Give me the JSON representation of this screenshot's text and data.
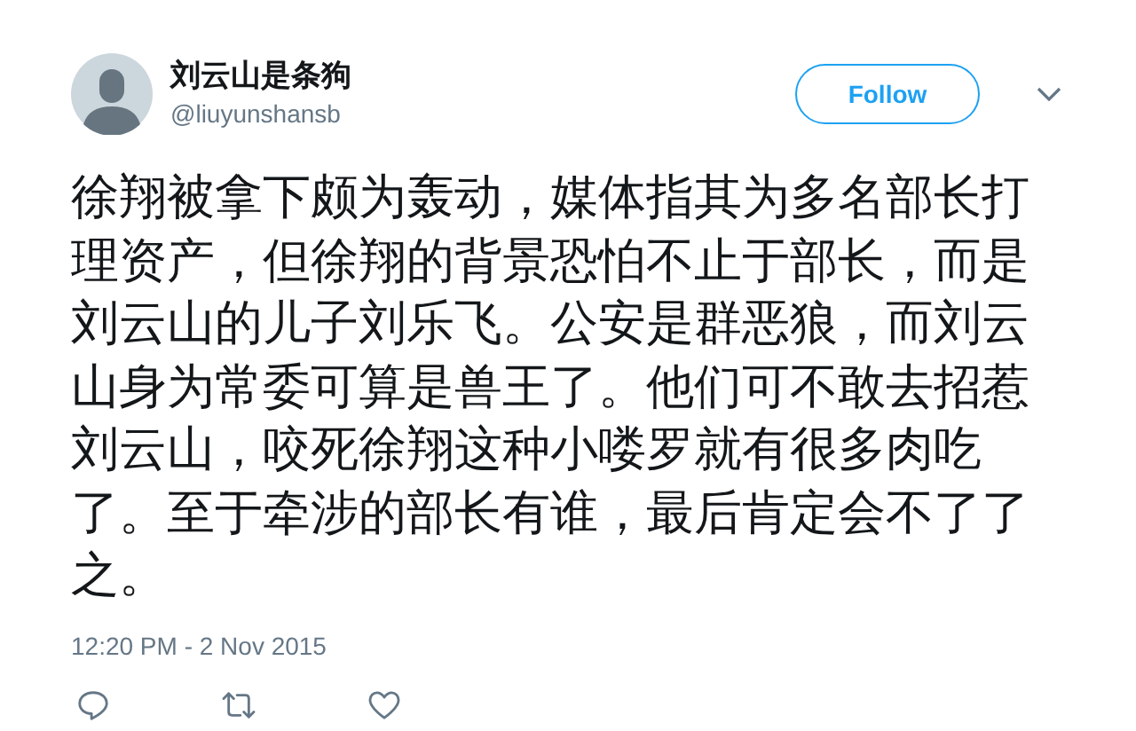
{
  "tweet": {
    "author": {
      "name": "刘云山是条狗",
      "handle": "@liuyunshansb"
    },
    "follow_button": {
      "label": "Follow"
    },
    "text": "徐翔被拿下颇为轰动，媒体指其为多名部长打理资产，但徐翔的背景恐怕不止于部长，而是刘云山的儿子刘乐飞。公安是群恶狼，而刘云山身为常委可算是兽王了。他们可不敢去招惹刘云山，咬死徐翔这种小喽罗就有很多肉吃了。至于牵涉的部长有谁，最后肯定会不了了之。",
    "timestamp": "12:20 PM - 2 Nov 2015"
  }
}
